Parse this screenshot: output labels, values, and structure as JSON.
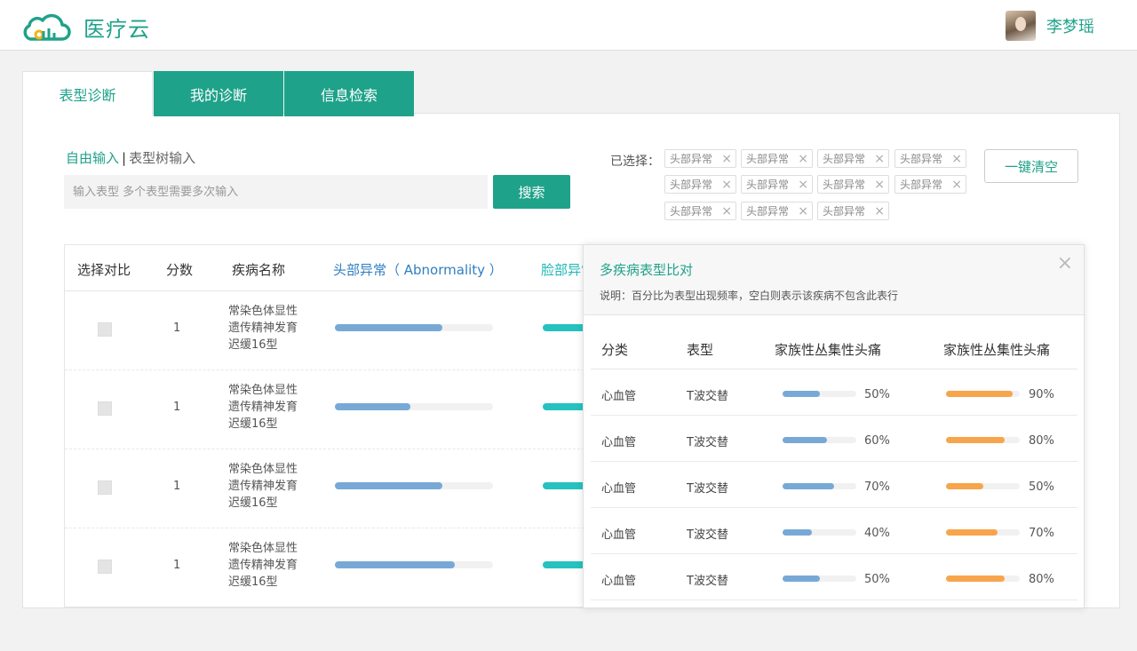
{
  "header": {
    "logo_text": "医疗云",
    "user_name": "李梦瑶"
  },
  "tabs": [
    {
      "label": "表型诊断"
    },
    {
      "label": "我的诊断"
    },
    {
      "label": "信息检索"
    }
  ],
  "input_mode": {
    "active": "自由输入",
    "separator": "|",
    "other": "表型树输入"
  },
  "search": {
    "placeholder": "输入表型 多个表型需要多次输入",
    "button": "搜索"
  },
  "selected": {
    "label": "已选择：",
    "chips": [
      "头部异常",
      "头部异常",
      "头部异常",
      "头部异常",
      "头部异常",
      "头部异常",
      "头部异常",
      "头部异常",
      "头部异常",
      "头部异常",
      "头部异常"
    ],
    "remove_glyph": "×",
    "clear_button": "一键清空"
  },
  "table": {
    "headers": {
      "select": "选择对比",
      "score": "分数",
      "disease": "疾病名称",
      "phenotype1": "头部异常（ Abnormality ）",
      "phenotype2": "脸部异常"
    },
    "rows": [
      {
        "score": "1",
        "disease_lines": [
          "常染色体显性",
          "遗传精神发育",
          "迟缓16型"
        ],
        "bar1": 0.68
      },
      {
        "score": "1",
        "disease_lines": [
          "常染色体显性",
          "遗传精神发育",
          "迟缓16型"
        ],
        "bar1": 0.48
      },
      {
        "score": "1",
        "disease_lines": [
          "常染色体显性",
          "遗传精神发育",
          "迟缓16型"
        ],
        "bar1": 0.68
      },
      {
        "score": "1",
        "disease_lines": [
          "常染色体显性",
          "遗传精神发育",
          "迟缓16型"
        ],
        "bar1": 0.76
      }
    ]
  },
  "popup": {
    "title": "多疾病表型比对",
    "note": "说明：百分比为表型出现频率，空白则表示该疾病不包含此表行",
    "close_glyph": "×",
    "headers": {
      "category": "分类",
      "phenotype": "表型",
      "disease1": "家族性丛集性头痛",
      "disease2": "家族性丛集性头痛"
    },
    "rows": [
      {
        "category": "心血管",
        "phenotype": "T波交替",
        "v1": 0.5,
        "v1_label": "50%",
        "v2": 0.9,
        "v2_label": "90%"
      },
      {
        "category": "心血管",
        "phenotype": "T波交替",
        "v1": 0.6,
        "v1_label": "60%",
        "v2": 0.8,
        "v2_label": "80%"
      },
      {
        "category": "心血管",
        "phenotype": "T波交替",
        "v1": 0.7,
        "v1_label": "70%",
        "v2": 0.5,
        "v2_label": "50%"
      },
      {
        "category": "心血管",
        "phenotype": "T波交替",
        "v1": 0.4,
        "v1_label": "40%",
        "v2": 0.7,
        "v2_label": "70%"
      },
      {
        "category": "心血管",
        "phenotype": "T波交替",
        "v1": 0.5,
        "v1_label": "50%",
        "v2": 0.8,
        "v2_label": "80%"
      }
    ]
  },
  "colors": {
    "accent": "#1fa28a",
    "bar_blue": "#78a9d6",
    "bar_teal": "#25c2c0",
    "bar_orange": "#f7a54c"
  },
  "icons": {
    "logo": "cloud-icon",
    "close": "close-icon",
    "chip_remove": "close-icon"
  }
}
